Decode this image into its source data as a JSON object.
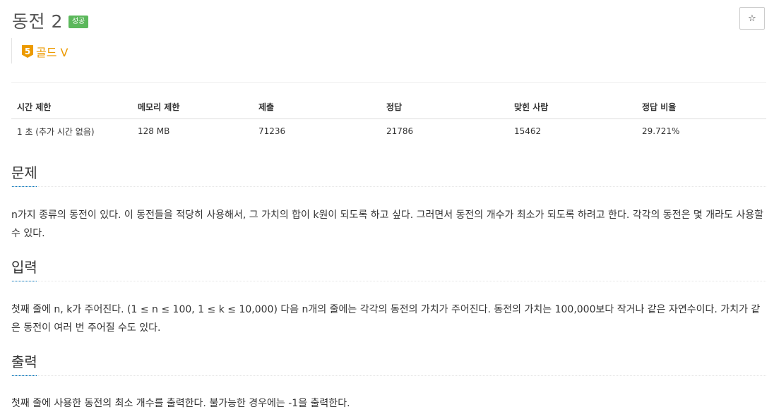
{
  "problem": {
    "title": "동전 2",
    "result_badge": "성공",
    "star_icon": "☆",
    "tier_number": "5",
    "tier_label": "골드 V",
    "tier_color": "#ec9a00"
  },
  "stats": {
    "headers": [
      "시간 제한",
      "메모리 제한",
      "제출",
      "정답",
      "맞힌 사람",
      "정답 비율"
    ],
    "values": [
      "1 초 (추가 시간 없음)",
      "128 MB",
      "71236",
      "21786",
      "15462",
      "29.721%"
    ]
  },
  "sections": {
    "problem_heading": "문제",
    "problem_text": "n가지 종류의 동전이 있다. 이 동전들을 적당히 사용해서, 그 가치의 합이 k원이 되도록 하고 싶다. 그러면서 동전의 개수가 최소가 되도록 하려고 한다. 각각의 동전은 몇 개라도 사용할 수 있다.",
    "input_heading": "입력",
    "input_text": "첫째 줄에 n, k가 주어진다. (1 ≤ n ≤ 100, 1 ≤ k ≤ 10,000) 다음 n개의 줄에는 각각의 동전의 가치가 주어진다. 동전의 가치는 100,000보다 작거나 같은 자연수이다. 가치가 같은 동전이 여러 번 주어질 수도 있다.",
    "output_heading": "출력",
    "output_text": "첫째 줄에 사용한 동전의 최소 개수를 출력한다. 불가능한 경우에는 -1을 출력한다."
  },
  "colors": {
    "success": "#5cb85c",
    "accent": "#0076c0"
  }
}
